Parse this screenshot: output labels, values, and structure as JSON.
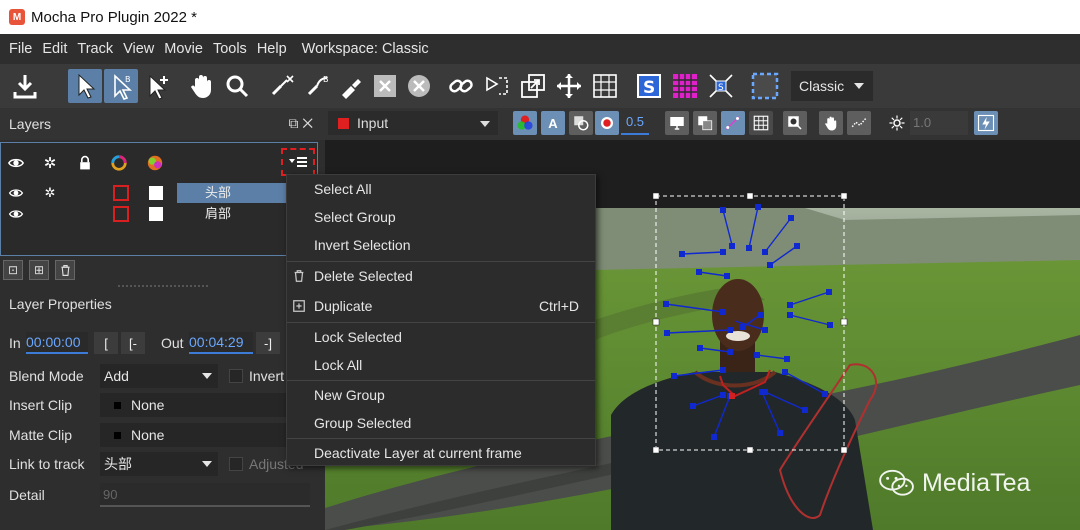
{
  "window": {
    "title": "Mocha Pro Plugin 2022 *",
    "app_icon_letter": "M"
  },
  "menubar": {
    "items": [
      "File",
      "Edit",
      "Track",
      "View",
      "Movie",
      "Tools",
      "Help"
    ],
    "workspace": "Workspace: Classic"
  },
  "toolbar": {
    "workspace_select": "Classic"
  },
  "layers_panel": {
    "title": "Layers",
    "window_icons": "⧉ ✕",
    "layers": [
      {
        "name": "头部",
        "selected": true
      },
      {
        "name": "肩部",
        "selected": false
      }
    ]
  },
  "view_toolbar": {
    "input_select": "Input",
    "opacity": "0.5",
    "value": "1.0"
  },
  "layer_properties": {
    "title": "Layer Properties",
    "in_label": "In",
    "in_value": "00:00:00",
    "out_label": "Out",
    "out_value": "00:04:29",
    "btn_set_in": "[",
    "btn_go_in": "[-",
    "btn_set_out": "-]",
    "blend_mode_label": "Blend Mode",
    "blend_mode_value": "Add",
    "invert_label": "Invert",
    "insert_clip_label": "Insert Clip",
    "insert_clip_value": "None",
    "matte_clip_label": "Matte Clip",
    "matte_clip_value": "None",
    "link_track_label": "Link to track",
    "link_track_value": "头部",
    "adjusted_label": "Adjusted",
    "detail_label": "Detail",
    "detail_value": "90"
  },
  "context_menu": {
    "items": [
      {
        "label": "Select All"
      },
      {
        "label": "Select Group"
      },
      {
        "label": "Invert Selection"
      },
      {
        "label": "Delete Selected",
        "icon": "trash-icon"
      },
      {
        "label": "Duplicate",
        "icon": "duplicate-icon",
        "shortcut": "Ctrl+D"
      },
      {
        "label": "Lock Selected"
      },
      {
        "label": "Lock All"
      },
      {
        "label": "New Group"
      },
      {
        "label": "Group Selected"
      },
      {
        "label": "Deactivate Layer at current frame"
      }
    ]
  },
  "watermark": {
    "text": "MediaTea"
  },
  "colors": {
    "accent": "#5b7fa6",
    "highlight_red": "#e02020",
    "tracking_blue": "#1028d0"
  }
}
